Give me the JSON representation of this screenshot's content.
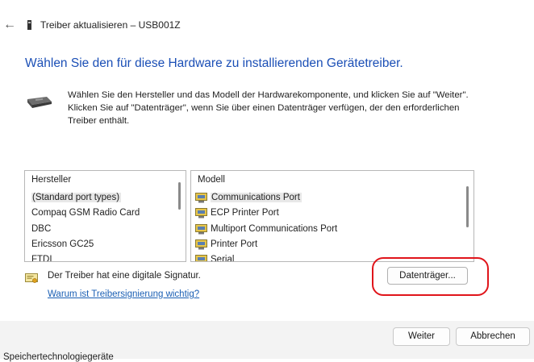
{
  "window": {
    "title": "Treiber aktualisieren – USB001Z",
    "back_symbol": "←"
  },
  "heading": "Wählen Sie den für diese Hardware zu installierenden Gerätetreiber.",
  "description": "Wählen Sie den Hersteller und das Modell der Hardwarekomponente, und klicken Sie auf \"Weiter\". Klicken Sie auf \"Datenträger\", wenn Sie über einen Datenträger verfügen, der den erforderlichen Treiber enthält.",
  "manufacturer_list": {
    "header": "Hersteller",
    "items": [
      "(Standard port types)",
      "Compaq GSM Radio Card",
      "DBC",
      "Ericsson GC25",
      "FTDI"
    ],
    "selected_index": 0
  },
  "model_list": {
    "header": "Modell",
    "items": [
      "Communications Port",
      "ECP Printer Port",
      "Multiport Communications Port",
      "Printer Port",
      "Serial"
    ],
    "selected_index": 0
  },
  "signature": {
    "text": "Der Treiber hat eine digitale Signatur.",
    "link": "Warum ist Treibersignierung wichtig?"
  },
  "buttons": {
    "have_disk": "Datenträger...",
    "next": "Weiter",
    "cancel": "Abbrechen"
  },
  "bottom_text": "Speichertechnologiegeräte",
  "colors": {
    "heading": "#1b4fb6",
    "link": "#1a5fb4",
    "highlight": "#e0151b"
  },
  "icons": [
    "back-arrow-icon",
    "usb-device-icon",
    "hardware-device-icon",
    "port-icon",
    "certificate-icon"
  ]
}
